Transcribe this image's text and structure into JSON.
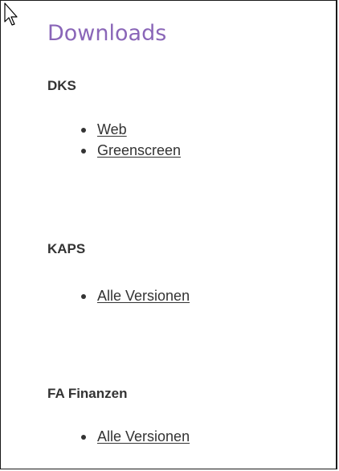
{
  "downloads": {
    "title": "Downloads",
    "sections": [
      {
        "heading": "DKS",
        "links": [
          "Web",
          "Greenscreen"
        ]
      },
      {
        "heading": "KAPS",
        "links": [
          "Alle Versionen"
        ]
      },
      {
        "heading": "FA Finanzen",
        "links": [
          "Alle Versionen"
        ]
      }
    ]
  },
  "icons": {
    "cursor": "mouse-pointer-icon"
  }
}
